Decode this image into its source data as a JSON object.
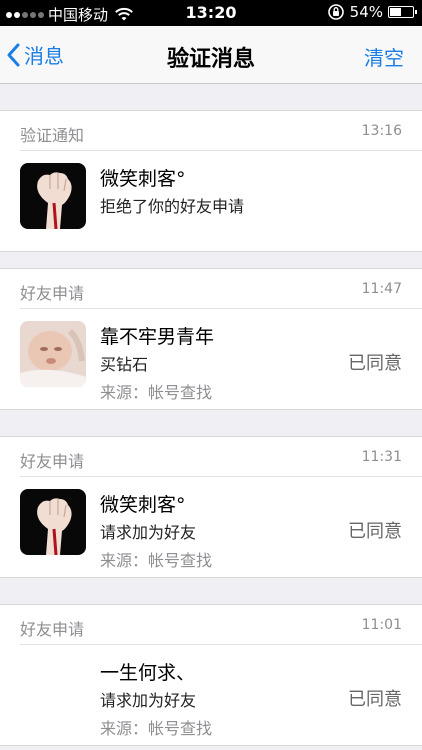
{
  "status_bar": {
    "carrier": "中国移动",
    "time": "13:20",
    "battery": "54%",
    "battery_level": 0.54,
    "signal_bars_filled": 2
  },
  "nav": {
    "back_label": "消息",
    "title": "验证消息",
    "action_label": "清空"
  },
  "sections": [
    {
      "type": "验证通知",
      "time": "13:16",
      "name": "微笑刺客°",
      "message": "拒绝了你的好友申请",
      "avatar": "fist-avatar"
    },
    {
      "type": "好友申请",
      "time": "11:47",
      "name": "靠不牢男青年",
      "message": "买钻石",
      "source": "来源：帐号查找",
      "status": "已同意",
      "avatar": "baby-avatar"
    },
    {
      "type": "好友申请",
      "time": "11:31",
      "name": "微笑刺客°",
      "message": "请求加为好友",
      "source": "来源：帐号查找",
      "status": "已同意",
      "avatar": "fist-avatar"
    },
    {
      "type": "好友申请",
      "time": "11:01",
      "name": "一生何求、",
      "message": "请求加为好友",
      "source": "来源：帐号查找",
      "status": "已同意",
      "avatar": "blank-avatar"
    }
  ],
  "colors": {
    "accent": "#1a7ee6",
    "background": "#efeff4",
    "secondary_text": "#8e8e93"
  }
}
